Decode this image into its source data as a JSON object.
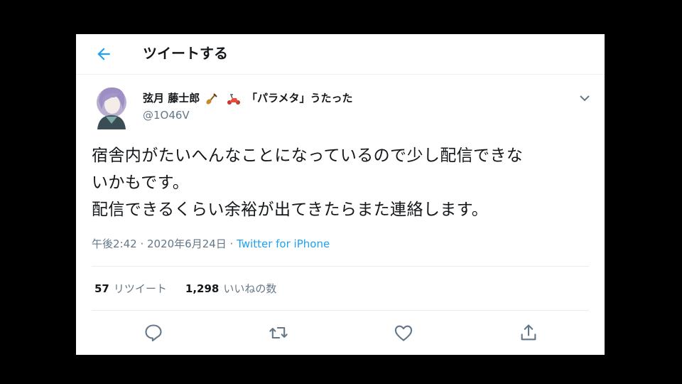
{
  "header": {
    "title": "ツイートする",
    "back_icon": "back-arrow-icon",
    "accent": "#1da1f2"
  },
  "user": {
    "display_name": "弦月 藤士郎",
    "name_suffix": "「パラメタ」うたった",
    "emojis": [
      "violin-icon",
      "scooter-icon"
    ],
    "handle": "@1O46V"
  },
  "tweet": {
    "lines": [
      "宿舎内がたいへんなことになっているので少し配信できな",
      "いかもです。",
      "配信できるくらい余裕が出てきたらまた連絡します。"
    ],
    "timestamp": "午後2:42 · 2020年6月24日 · ",
    "source": "Twitter for iPhone"
  },
  "stats": {
    "retweets": "57",
    "retweets_label": "リツイート",
    "likes": "1,298",
    "likes_label": "いいねの数"
  },
  "actions": [
    "reply-icon",
    "retweet-icon",
    "like-icon",
    "share-icon"
  ],
  "colors": {
    "text": "#14171a",
    "secondary": "#657786",
    "link": "#1da1f2",
    "divider": "#e6ecf0"
  }
}
